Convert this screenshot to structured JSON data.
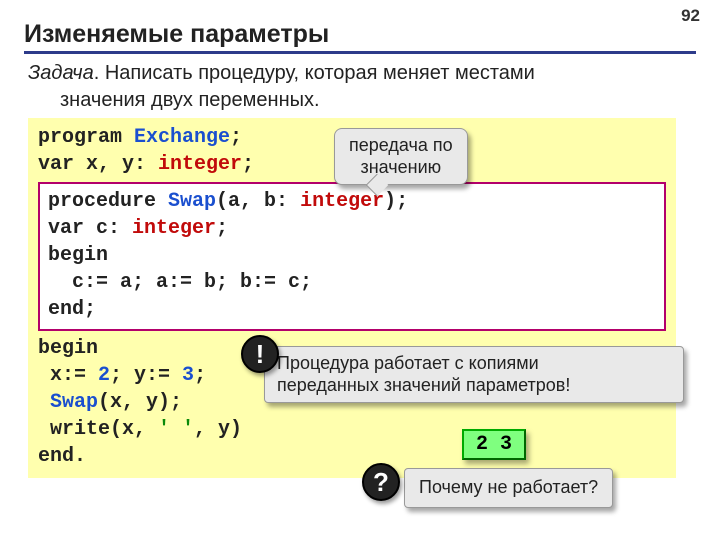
{
  "page_number": "92",
  "title": "Изменяемые параметры",
  "task_label": "Задача",
  "task_text_1": ". Написать процедуру, которая меняет местами",
  "task_text_2": "значения двух переменных.",
  "callout_top_1": "передача по",
  "callout_top_2": "значению",
  "code": {
    "l1a": "program ",
    "l1b": "Exchange",
    "l1c": ";",
    "l2a": "var x, y: ",
    "l2b": "integer",
    "l2c": ";",
    "p1a": "procedure ",
    "p1b": "Swap",
    "p1c": "(a, b: ",
    "p1d": "integer",
    "p1e": ");",
    "p2a": "var c: ",
    "p2b": "integer",
    "p2c": ";",
    "p3": "begin",
    "p4": "  c:= a; a:= b; b:= c;",
    "p5": "end;",
    "b1": "begin",
    "b2a": " x:= ",
    "b2b": "2",
    "b2c": "; y:= ",
    "b2d": "3",
    "b2e": ";",
    "b3a": " ",
    "b3b": "Swap",
    "b3c": "(x, y);",
    "b4a": " write(x, ",
    "b4b": "' '",
    "b4c": ", y)",
    "b5": "end."
  },
  "note_excl_1": "Процедура работает с копиями",
  "note_excl_2": "переданных значений параметров!",
  "output": "2 3",
  "note_q": "Почему не работает?",
  "badge_excl": "!",
  "badge_q": "?"
}
